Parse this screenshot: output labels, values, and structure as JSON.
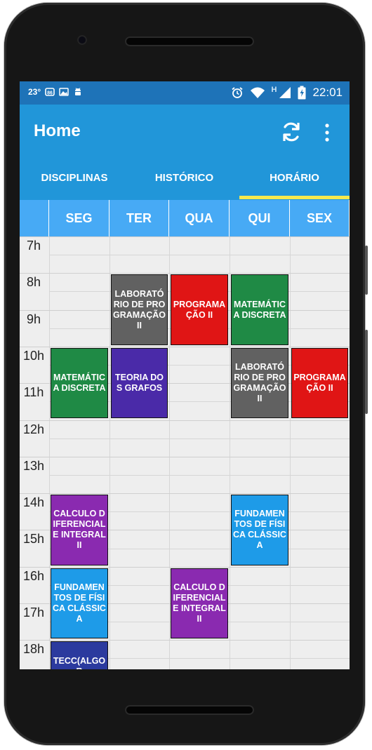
{
  "status_bar": {
    "temperature": "23°",
    "time": "22:01",
    "network_label": "H",
    "icons": [
      "weather-icon",
      "photo-icon",
      "android-icon",
      "alarm-icon",
      "wifi-icon",
      "signal-icon",
      "battery-icon"
    ]
  },
  "app_bar": {
    "title": "Home",
    "actions": [
      "refresh-icon",
      "more-vert-icon"
    ]
  },
  "tabs": [
    {
      "label": "DISCIPLINAS",
      "selected": false
    },
    {
      "label": "HISTÓRICO",
      "selected": false
    },
    {
      "label": "HORÁRIO",
      "selected": true
    }
  ],
  "schedule": {
    "days": [
      "SEG",
      "TER",
      "QUA",
      "QUI",
      "SEX"
    ],
    "hours": [
      "7h",
      "8h",
      "9h",
      "10h",
      "11h",
      "12h",
      "13h",
      "14h",
      "15h",
      "16h",
      "17h",
      "18h"
    ],
    "events": [
      {
        "title": "LABORATÓRIO DE PROGRAMAÇÃO II",
        "day": "TER",
        "start": "8h",
        "end": "10h",
        "color": "#616161"
      },
      {
        "title": "PROGRAMAÇÃO II",
        "day": "QUA",
        "start": "8h",
        "end": "10h",
        "color": "#e01515"
      },
      {
        "title": "MATEMÁTICA DISCRETA",
        "day": "QUI",
        "start": "8h",
        "end": "10h",
        "color": "#1f8a45"
      },
      {
        "title": "MATEMÁTICA DISCRETA",
        "day": "SEG",
        "start": "10h",
        "end": "12h",
        "color": "#1f8a45"
      },
      {
        "title": "TEORIA DOS GRAFOS",
        "day": "TER",
        "start": "10h",
        "end": "12h",
        "color": "#4a2aa8"
      },
      {
        "title": "LABORATÓRIO DE PROGRAMAÇÃO II",
        "day": "QUI",
        "start": "10h",
        "end": "12h",
        "color": "#616161"
      },
      {
        "title": "PROGRAMAÇÃO II",
        "day": "SEX",
        "start": "10h",
        "end": "12h",
        "color": "#e01515"
      },
      {
        "title": "CALCULO DIFERENCIAL E INTEGRAL II",
        "day": "SEG",
        "start": "14h",
        "end": "16h",
        "color": "#8a2ab0"
      },
      {
        "title": "FUNDAMENTOS DE FÍSICA CLÁSSICA",
        "day": "QUI",
        "start": "14h",
        "end": "16h",
        "color": "#1e9be8"
      },
      {
        "title": "FUNDAMENTOS DE FÍSICA CLÁSSICA",
        "day": "SEG",
        "start": "16h",
        "end": "18h",
        "color": "#1e9be8"
      },
      {
        "title": "CALCULO DIFERENCIAL E INTEGRAL II",
        "day": "QUA",
        "start": "16h",
        "end": "18h",
        "color": "#8a2ab0"
      },
      {
        "title": "TECC(ALGOR",
        "day": "SEG",
        "start": "18h",
        "end": "20h",
        "color": "#2b3a9e"
      }
    ]
  },
  "colors": {
    "status_bar": "#1e73b8",
    "app_bar": "#2196d9",
    "tab_indicator": "#f5e94d",
    "day_header": "#47aaf5",
    "grid_background": "#eeeeee"
  }
}
